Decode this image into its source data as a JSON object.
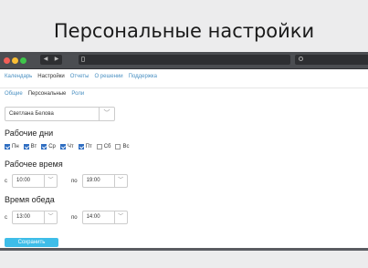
{
  "slide": {
    "title": "Персональные настройки"
  },
  "browser": {
    "back_icon": "◀",
    "forward_icon": "▶"
  },
  "menu": {
    "items": [
      "Календарь",
      "Настройки",
      "Отчеты",
      "О решении",
      "Поддержка"
    ],
    "active": "Настройки"
  },
  "subtabs": {
    "items": [
      "Общие",
      "Персональные",
      "Роли"
    ],
    "active": "Персональные"
  },
  "user_select": {
    "value": "Светлана Белова"
  },
  "workdays": {
    "heading": "Рабочие дни",
    "days": [
      {
        "label": "Пн",
        "checked": true
      },
      {
        "label": "Вт",
        "checked": true
      },
      {
        "label": "Ср",
        "checked": true
      },
      {
        "label": "Чт",
        "checked": true
      },
      {
        "label": "Пт",
        "checked": true
      },
      {
        "label": "Сб",
        "checked": false
      },
      {
        "label": "Вс",
        "checked": false
      }
    ]
  },
  "worktime": {
    "heading": "Рабочее время",
    "from_label": "с",
    "from_value": "10:00",
    "to_label": "по",
    "to_value": "19:00"
  },
  "lunch": {
    "heading": "Время обеда",
    "from_label": "с",
    "from_value": "13:00",
    "to_label": "по",
    "to_value": "14:00"
  },
  "save_button": {
    "label": "Сохранить"
  },
  "colors": {
    "accent": "#3ebde8",
    "link": "#4a90c2",
    "checkbox": "#2f6ec2"
  }
}
